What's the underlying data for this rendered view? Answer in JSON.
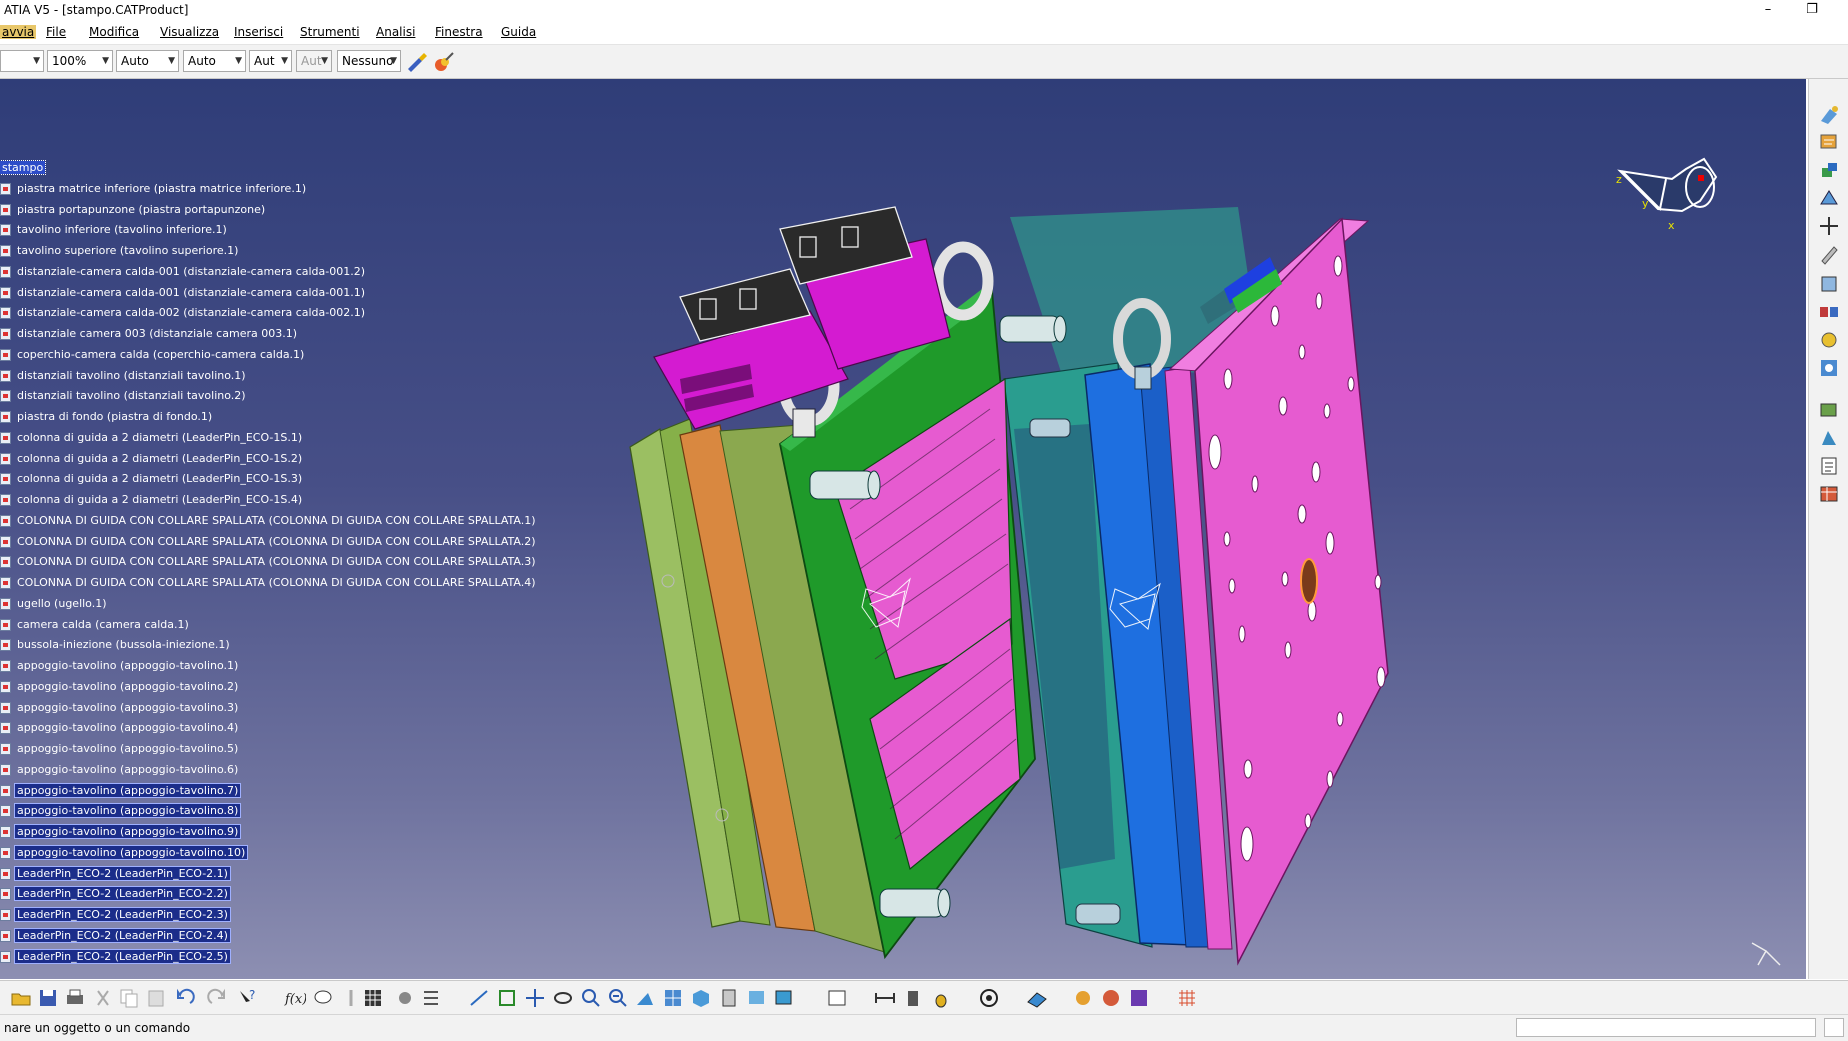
{
  "window": {
    "title": "ATIA V5 - [stampo.CATProduct]",
    "minimize": "–",
    "restore": "❐"
  },
  "menu": {
    "items": [
      "avvia",
      "File",
      "Modifica",
      "Visualizza",
      "Inserisci",
      "Strumenti",
      "Analisi",
      "Finestra",
      "Guida"
    ]
  },
  "properties_toolbar": {
    "zoom": "100%",
    "linetype": "Auto",
    "thickness": "Auto",
    "layer_short": "Aut",
    "layer_disabled": "Aut",
    "render": "Nessuno"
  },
  "tree": {
    "root": "stampo",
    "nodes": [
      "piastra matrice inferiore (piastra matrice inferiore.1)",
      "piastra portapunzone (piastra portapunzone)",
      "tavolino inferiore (tavolino inferiore.1)",
      "tavolino superiore (tavolino superiore.1)",
      "distanziale-camera calda-001 (distanziale-camera calda-001.2)",
      "distanziale-camera calda-001 (distanziale-camera calda-001.1)",
      "distanziale-camera calda-002 (distanziale-camera calda-002.1)",
      "distanziale camera 003 (distanziale camera 003.1)",
      "coperchio-camera calda (coperchio-camera calda.1)",
      "distanziali tavolino (distanziali tavolino.1)",
      "distanziali tavolino (distanziali tavolino.2)",
      "piastra di fondo (piastra di fondo.1)",
      "colonna di guida a 2 diametri (LeaderPin_ECO-1S.1)",
      "colonna di guida a 2 diametri (LeaderPin_ECO-1S.2)",
      "colonna di guida a 2 diametri (LeaderPin_ECO-1S.3)",
      "colonna di guida a 2 diametri (LeaderPin_ECO-1S.4)",
      "COLONNA DI GUIDA CON COLLARE SPALLATA (COLONNA DI GUIDA CON COLLARE SPALLATA.1)",
      "COLONNA DI GUIDA CON COLLARE SPALLATA (COLONNA DI GUIDA CON COLLARE SPALLATA.2)",
      "COLONNA DI GUIDA CON COLLARE SPALLATA (COLONNA DI GUIDA CON COLLARE SPALLATA.3)",
      "COLONNA DI GUIDA CON COLLARE SPALLATA (COLONNA DI GUIDA CON COLLARE SPALLATA.4)",
      "ugello (ugello.1)",
      "camera calda (camera calda.1)",
      "bussola-iniezione (bussola-iniezione.1)",
      "appoggio-tavolino (appoggio-tavolino.1)",
      "appoggio-tavolino (appoggio-tavolino.2)",
      "appoggio-tavolino (appoggio-tavolino.3)",
      "appoggio-tavolino (appoggio-tavolino.4)",
      "appoggio-tavolino (appoggio-tavolino.5)",
      "appoggio-tavolino (appoggio-tavolino.6)",
      "appoggio-tavolino (appoggio-tavolino.7)",
      "appoggio-tavolino (appoggio-tavolino.8)",
      "appoggio-tavolino (appoggio-tavolino.9)",
      "appoggio-tavolino (appoggio-tavolino.10)",
      "LeaderPin_ECO-2 (LeaderPin_ECO-2.1)",
      "LeaderPin_ECO-2 (LeaderPin_ECO-2.2)",
      "LeaderPin_ECO-2 (LeaderPin_ECO-2.3)",
      "LeaderPin_ECO-2 (LeaderPin_ECO-2.4)",
      "LeaderPin_ECO-2 (LeaderPin_ECO-2.5)"
    ],
    "selected_from": 29
  },
  "compass": {
    "axis_x": "x",
    "axis_y": "y",
    "axis_z": "z"
  },
  "status": {
    "message": "nare un oggetto o un comando"
  },
  "colors": {
    "background_top": "#2f3d78",
    "background_bottom": "#8d8fb2",
    "plate_pink": "#e65bd0",
    "plate_green": "#1f9a2a",
    "plate_blue": "#1e6fe0",
    "plate_magenta": "#d41bd1"
  }
}
